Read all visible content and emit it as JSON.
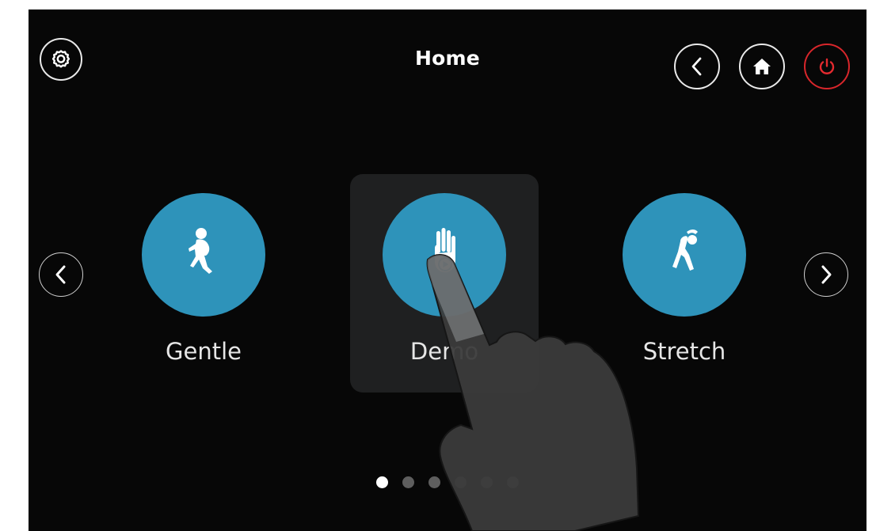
{
  "header": {
    "title": "Home",
    "settings_icon": "gear-icon",
    "back_icon": "chevron-left-icon",
    "home_icon": "house-icon",
    "power_icon": "power-icon"
  },
  "carousel": {
    "prev_icon": "chevron-left-icon",
    "next_icon": "chevron-right-icon",
    "selected": "Demo",
    "items": [
      {
        "label": "Gentle",
        "icon": "walking-person-icon"
      },
      {
        "label": "Demo",
        "icon": "hand-play-icon"
      },
      {
        "label": "Stretch",
        "icon": "stretching-person-icon"
      }
    ]
  },
  "pagination": {
    "total": 6,
    "active_index": 0
  },
  "colors": {
    "background": "#070707",
    "accent": "#2e93ba",
    "selected_tile": "#1f2021",
    "power": "#d8262b",
    "dot_active": "#ffffff",
    "dot_inactive": "#5e5e5e"
  }
}
